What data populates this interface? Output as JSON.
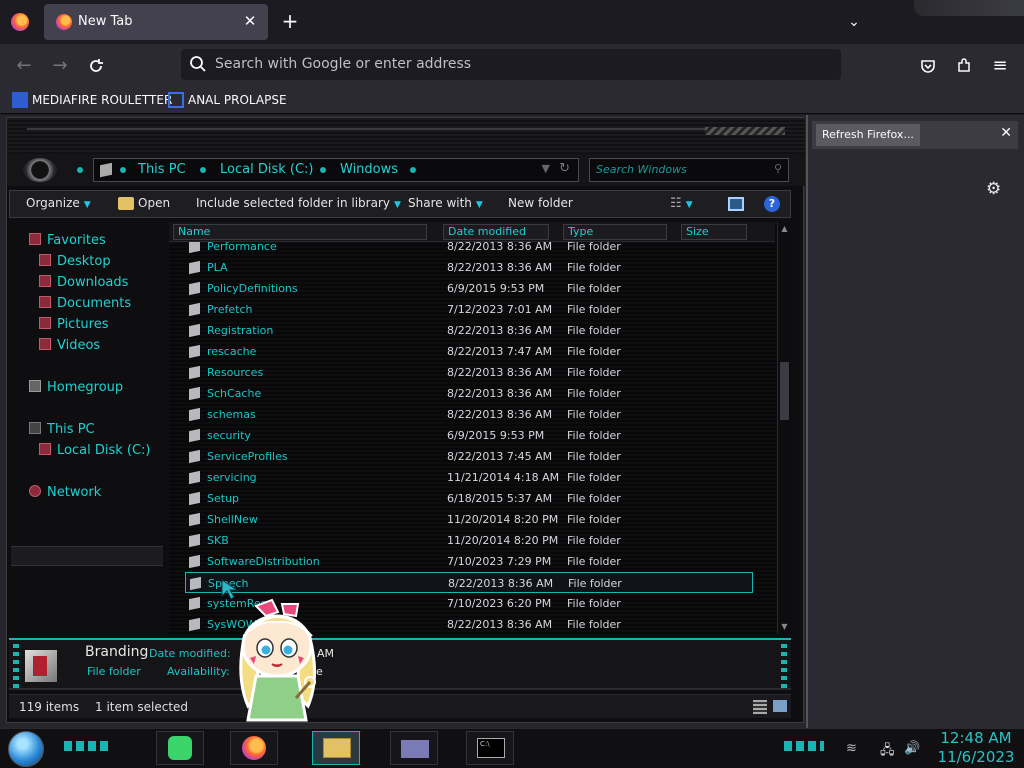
{
  "browser": {
    "tab_title": "New Tab",
    "tab_close": "✕",
    "new_tab": "+",
    "tab_list": "⌄",
    "urlbar_placeholder": "Search with Google or enter address",
    "bookmarks": [
      {
        "label": "MEDIAFIRE ROULETTER",
        "icon": "mediafire-icon"
      },
      {
        "label": "ANAL PROLAPSE",
        "icon": "bookmark-icon"
      }
    ]
  },
  "notification_panel": {
    "button_label": "Refresh Firefox...",
    "close": "✕",
    "gear": "⚙"
  },
  "explorer": {
    "breadcrumbs": [
      "This PC",
      "Local Disk (C:)",
      "Windows"
    ],
    "search_placeholder": "Search Windows",
    "commands": {
      "organize": "Organize",
      "open": "Open",
      "include": "Include selected folder in library",
      "share": "Share with",
      "new_folder": "New folder"
    },
    "nav": {
      "favorites": "Favorites",
      "desktop": "Desktop",
      "downloads": "Downloads",
      "documents": "Documents",
      "pictures": "Pictures",
      "videos": "Videos",
      "homegroup": "Homegroup",
      "this_pc": "This PC",
      "local_disk": "Local Disk (C:)",
      "network": "Network"
    },
    "columns": {
      "name": "Name",
      "date": "Date modified",
      "type": "Type",
      "size": "Size"
    },
    "rows": [
      {
        "name": "Performance",
        "date": "8/22/2013 8:36 AM",
        "type": "File folder"
      },
      {
        "name": "PLA",
        "date": "8/22/2013 8:36 AM",
        "type": "File folder"
      },
      {
        "name": "PolicyDefinitions",
        "date": "6/9/2015 9:53 PM",
        "type": "File folder"
      },
      {
        "name": "Prefetch",
        "date": "7/12/2023 7:01 AM",
        "type": "File folder"
      },
      {
        "name": "Registration",
        "date": "8/22/2013 8:36 AM",
        "type": "File folder"
      },
      {
        "name": "rescache",
        "date": "8/22/2013 7:47 AM",
        "type": "File folder"
      },
      {
        "name": "Resources",
        "date": "8/22/2013 8:36 AM",
        "type": "File folder"
      },
      {
        "name": "SchCache",
        "date": "8/22/2013 8:36 AM",
        "type": "File folder"
      },
      {
        "name": "schemas",
        "date": "8/22/2013 8:36 AM",
        "type": "File folder"
      },
      {
        "name": "security",
        "date": "6/9/2015 9:53 PM",
        "type": "File folder"
      },
      {
        "name": "ServiceProfiles",
        "date": "8/22/2013 7:45 AM",
        "type": "File folder"
      },
      {
        "name": "servicing",
        "date": "11/21/2014 4:18 AM",
        "type": "File folder"
      },
      {
        "name": "Setup",
        "date": "6/18/2015 5:37 AM",
        "type": "File folder"
      },
      {
        "name": "ShellNew",
        "date": "11/20/2014 8:20 PM",
        "type": "File folder"
      },
      {
        "name": "SKB",
        "date": "11/20/2014 8:20 PM",
        "type": "File folder"
      },
      {
        "name": "SoftwareDistribution",
        "date": "7/10/2023 7:29 PM",
        "type": "File folder"
      },
      {
        "name": "Speech",
        "date": "8/22/2013 8:36 AM",
        "type": "File folder"
      },
      {
        "name": "systemRes",
        "date": "7/10/2023 6:20 PM",
        "type": "File folder"
      },
      {
        "name": "SysWOW64",
        "date": "8/22/2013 8:36 AM",
        "type": "File folder"
      }
    ],
    "details": {
      "name": "Branding",
      "type": "File folder",
      "date_label": "Date modified:",
      "date_value": "AM",
      "avail_label": "Availability:",
      "avail_value": "ne"
    },
    "status": {
      "items": "119 items",
      "selected": "1 item selected"
    }
  },
  "taskbar": {
    "apps": [
      "notes-app",
      "firefox",
      "file-explorer",
      "control-panel",
      "command-prompt"
    ],
    "time": "12:48 AM",
    "date": "11/6/2023"
  }
}
